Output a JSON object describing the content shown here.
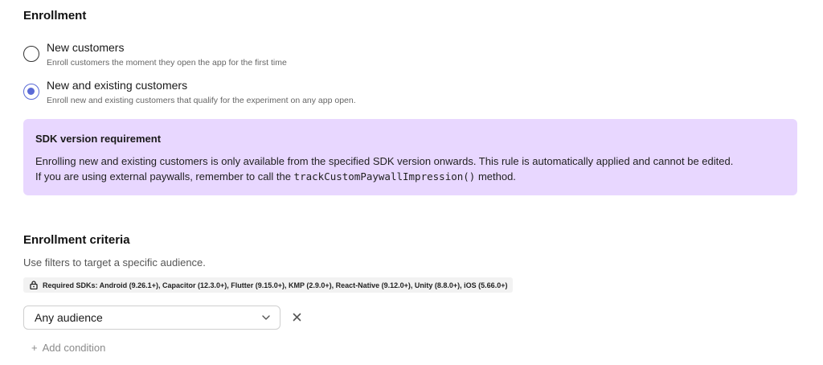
{
  "enrollment": {
    "title": "Enrollment",
    "options": [
      {
        "label": "New customers",
        "description": "Enroll customers the moment they open the app for the first time",
        "selected": false
      },
      {
        "label": "New and existing customers",
        "description": "Enroll new and existing customers that qualify for the experiment on any app open.",
        "selected": true
      }
    ]
  },
  "callout": {
    "title": "SDK version requirement",
    "line1": "Enrolling new and existing customers is only available from the specified SDK version onwards. This rule is automatically applied and cannot be edited.",
    "line2_before": "If you are using external paywalls, remember to call the ",
    "line2_code": "trackCustomPaywallImpression()",
    "line2_after": " method."
  },
  "criteria": {
    "title": "Enrollment criteria",
    "subtitle": "Use filters to target a specific audience.",
    "sdk_chip": "Required SDKs: Android (9.26.1+), Capacitor (12.3.0+), Flutter (9.15.0+), KMP (2.9.0+), React-Native (9.12.0+), Unity (8.8.0+), iOS (5.66.0+)",
    "select_value": "Any audience",
    "add_condition_plus": "+",
    "add_condition_label": "Add condition"
  },
  "icons": {
    "lock": "lock-icon",
    "chevron": "chevron-down-icon",
    "remove": "close-icon"
  },
  "colors": {
    "accent": "#5a6ad6",
    "callout_bg": "#e8d7ff"
  }
}
